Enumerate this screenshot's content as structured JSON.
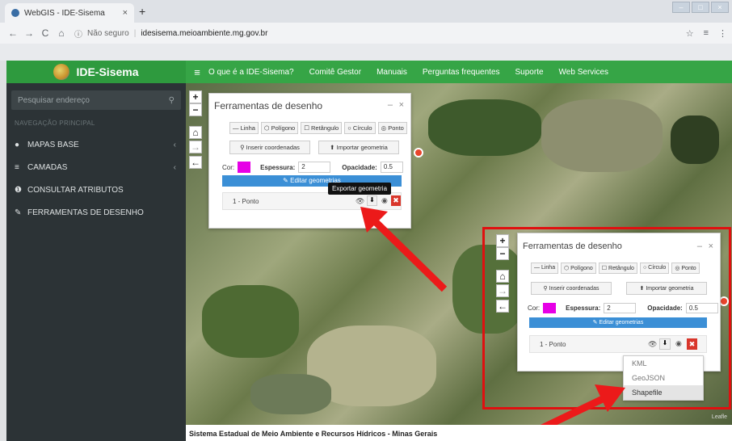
{
  "browser": {
    "tab_title": "WebGIS - IDE-Sisema",
    "tab_close": "×",
    "new_tab": "+",
    "insecure_label": "Não seguro",
    "url": "idesisema.meioambiente.mg.gov.br"
  },
  "app": {
    "brand": "IDE-Sisema",
    "topnav": [
      "O que é a IDE-Sisema?",
      "Comitê Gestor",
      "Manuais",
      "Perguntas frequentes",
      "Suporte",
      "Web Services"
    ],
    "footer": "Sistema Estadual de Meio Ambiente e Recursos Hídricos - Minas Gerais"
  },
  "sidebar": {
    "search_placeholder": "Pesquisar endereço",
    "nav_header": "NAVEGAÇÃO PRINCIPAL",
    "items": [
      {
        "label": "MAPAS BASE",
        "icon": "map-marker-icon"
      },
      {
        "label": "CAMADAS",
        "icon": "layers-icon"
      },
      {
        "label": "CONSULTAR ATRIBUTOS",
        "icon": "info-icon"
      },
      {
        "label": "FERRAMENTAS DE DESENHO",
        "icon": "edit-icon"
      }
    ]
  },
  "draw_panel": {
    "title": "Ferramentas de desenho",
    "minimize": "–",
    "close": "×",
    "tools": [
      "Linha",
      "Polígono",
      "Retângulo",
      "Círculo",
      "Ponto"
    ],
    "insert_coords": "Inserir coordenadas",
    "import_geometry": "Importar geometria",
    "color_label": "Cor:",
    "thickness_label": "Espessura:",
    "thickness_value": "2",
    "opacity_label": "Opacidade:",
    "opacity_value": "0.5",
    "edit_geometries": "Editar geometrias",
    "feature": "1 - Ponto",
    "color": "#e600e6"
  },
  "tooltip": "Exportar geometria",
  "export_menu": [
    "KML",
    "GeoJSON",
    "Shapefile"
  ],
  "map": {
    "attribution": "Leafle"
  }
}
